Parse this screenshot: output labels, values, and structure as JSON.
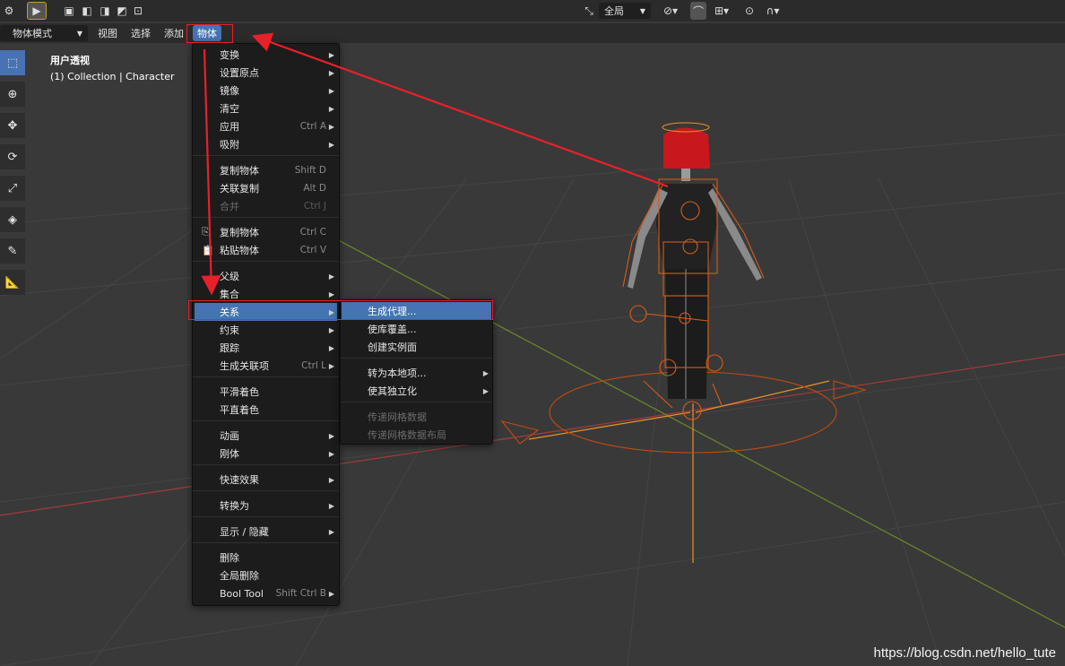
{
  "top_bar": {
    "transform_space_label": "全局"
  },
  "header": {
    "mode_label": "物体模式",
    "menus": [
      "视图",
      "选择",
      "添加",
      "物体"
    ]
  },
  "viewport": {
    "view_name": "用户透视",
    "collection_info": "(1) Collection | Character"
  },
  "object_menu": {
    "items": [
      {
        "label": "变换",
        "shortcut": "",
        "submenu": true
      },
      {
        "label": "设置原点",
        "shortcut": "",
        "submenu": true
      },
      {
        "label": "镜像",
        "shortcut": "",
        "submenu": true
      },
      {
        "label": "清空",
        "shortcut": "",
        "submenu": true
      },
      {
        "label": "应用",
        "shortcut": "Ctrl A",
        "submenu": true
      },
      {
        "label": "吸附",
        "shortcut": "",
        "submenu": true
      },
      {
        "label": "复制物体",
        "shortcut": "Shift D",
        "submenu": false
      },
      {
        "label": "关联复制",
        "shortcut": "Alt D",
        "submenu": false
      },
      {
        "label": "合并",
        "shortcut": "Ctrl J",
        "submenu": false
      },
      {
        "label": "复制物体",
        "shortcut": "Ctrl C",
        "submenu": false
      },
      {
        "label": "粘贴物体",
        "shortcut": "Ctrl V",
        "submenu": false
      },
      {
        "label": "父级",
        "shortcut": "",
        "submenu": true
      },
      {
        "label": "集合",
        "shortcut": "",
        "submenu": true
      },
      {
        "label": "关系",
        "shortcut": "",
        "submenu": true
      },
      {
        "label": "约束",
        "shortcut": "",
        "submenu": true
      },
      {
        "label": "跟踪",
        "shortcut": "",
        "submenu": true
      },
      {
        "label": "生成关联项",
        "shortcut": "Ctrl L",
        "submenu": true
      },
      {
        "label": "平滑着色",
        "shortcut": "",
        "submenu": false
      },
      {
        "label": "平直着色",
        "shortcut": "",
        "submenu": false
      },
      {
        "label": "动画",
        "shortcut": "",
        "submenu": true
      },
      {
        "label": "刚体",
        "shortcut": "",
        "submenu": true
      },
      {
        "label": "快速效果",
        "shortcut": "",
        "submenu": true
      },
      {
        "label": "转换为",
        "shortcut": "",
        "submenu": true
      },
      {
        "label": "显示 / 隐藏",
        "shortcut": "",
        "submenu": true
      },
      {
        "label": "删除",
        "shortcut": "",
        "submenu": false
      },
      {
        "label": "全局删除",
        "shortcut": "",
        "submenu": false
      },
      {
        "label": "Bool Tool",
        "shortcut": "Shift Ctrl B",
        "submenu": true
      }
    ]
  },
  "relations_submenu": {
    "items": [
      {
        "label": "生成代理...",
        "submenu": false
      },
      {
        "label": "使库覆盖...",
        "submenu": false
      },
      {
        "label": "创建实例面",
        "submenu": false
      },
      {
        "label": "转为本地项...",
        "submenu": true
      },
      {
        "label": "使其独立化",
        "submenu": true
      },
      {
        "label": "传递网格数据",
        "submenu": false
      },
      {
        "label": "传递网格数据布局",
        "submenu": false
      }
    ]
  },
  "watermark": "https://blog.csdn.net/hello_tute",
  "colors": {
    "highlight": "#4772b3",
    "annotation_red": "#e8202a",
    "rig_orange": "#e0661a"
  }
}
